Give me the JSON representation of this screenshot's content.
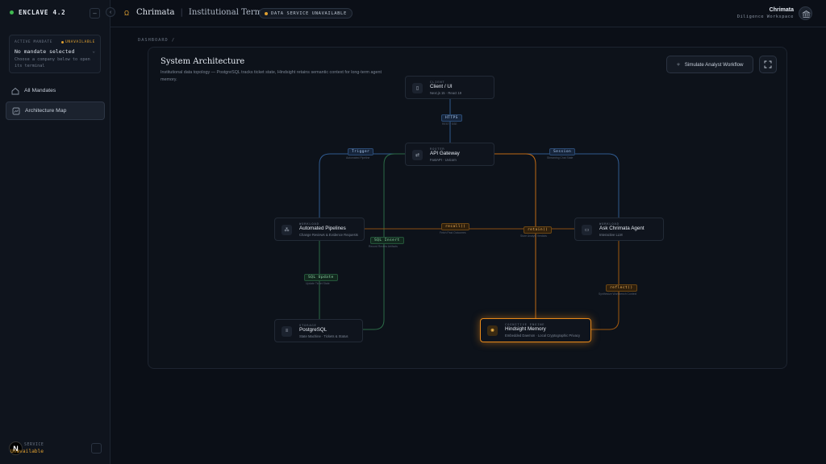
{
  "sidebar": {
    "brand": "ENCLAVE 4.2",
    "mandate": {
      "label": "ACTIVE MANDATE",
      "status": "UNAVAILABLE",
      "title": "No mandate selected",
      "desc": "Choose a company below to open its terminal"
    },
    "nav": [
      {
        "label": "All Mandates",
        "icon": "home-icon"
      },
      {
        "label": "Architecture Map",
        "icon": "map-icon",
        "active": true
      }
    ],
    "footer": {
      "avatar": "N",
      "label": "SERVICE",
      "value": "Unavailable"
    }
  },
  "header": {
    "logo": "Ω",
    "title": "Chrimata",
    "subtitle": "Institutional Terminal",
    "badge": "DATA SERVICE UNAVAILABLE",
    "user_name": "Chrimata",
    "workspace": "Diligence Workspace"
  },
  "breadcrumb": "DASHBOARD  /",
  "panel": {
    "title": "System Architecture",
    "desc": "Institutional data topology — PostgreSQL tracks ticket state, Hindsight retains semantic context for long-term agent memory.",
    "simulate_label": "Simulate Analyst Workflow"
  },
  "nodes": {
    "client": {
      "cat": "CLIENT",
      "name": "Client / UI",
      "sub": "Next.js 15 · React 19"
    },
    "gateway": {
      "cat": "ROUTER",
      "name": "API Gateway",
      "sub": "FastAPI · Uvicorn"
    },
    "pipelines": {
      "cat": "WORKLOAD",
      "name": "Automated Pipelines",
      "sub": "Change Reviews & Evidence Requests"
    },
    "agent": {
      "cat": "WORKLOAD",
      "name": "Ask Chrimata Agent",
      "sub": "Interactive LLM"
    },
    "postgres": {
      "cat": "STORAGE",
      "name": "PostgreSQL",
      "sub": "State Machine · Tickets & Status"
    },
    "hindsight": {
      "cat": "COGNITIVE ENGINE",
      "name": "Hindsight Memory",
      "sub": "Embedded Daemon · Local Cryptographic Privacy"
    }
  },
  "edges": {
    "https": {
      "label": "HTTPS",
      "sub": "REST / SSE"
    },
    "trigger": {
      "label": "Trigger",
      "sub": "Automated Pipeline"
    },
    "session": {
      "label": "Session",
      "sub": "Streaming Chat State"
    },
    "recall": {
      "label": "recall()",
      "sub": "Fetch Past Outcomes"
    },
    "retain": {
      "label": "retain()",
      "sub": "Store Analyst Verdicts"
    },
    "sql_insert": {
      "label": "SQL Insert",
      "sub": "Record Review Artifacts"
    },
    "sql_update": {
      "label": "SQL Update",
      "sub": "Update Ticket State"
    },
    "reflect": {
      "label": "reflect()",
      "sub": "Synthesize Workbench Context"
    }
  },
  "colors": {
    "accent": "#e8891a",
    "ok": "#3fb950",
    "warn": "#e0a030",
    "link_blue": "#2f5a8f",
    "link_green": "#2b6b47"
  }
}
